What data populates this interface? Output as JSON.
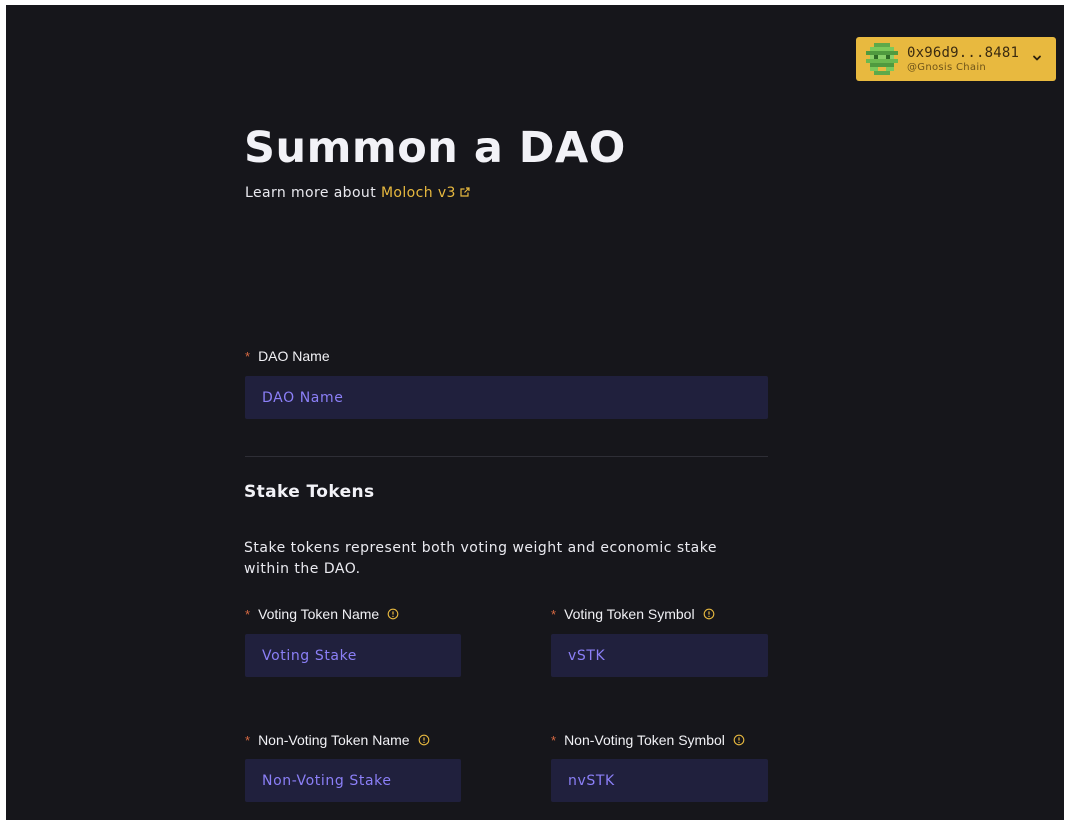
{
  "wallet": {
    "address": "0x96d9...8481",
    "network": "@Gnosis Chain",
    "avatar_icon": "pixel-avatar-icon",
    "chevron_icon": "chevron-down-icon",
    "color": "#e8b93f"
  },
  "header": {
    "title": "Summon a DAO",
    "learn_more_prefix": "Learn more about",
    "learn_more_link": "Moloch v3",
    "external_link_icon": "external-link-icon"
  },
  "form": {
    "dao_name": {
      "required_mark": "*",
      "label": "DAO Name",
      "placeholder": "DAO Name",
      "value": ""
    },
    "stake_tokens": {
      "title": "Stake Tokens",
      "description": "Stake tokens represent both voting weight and economic stake within the DAO.",
      "voting_token_name": {
        "required_mark": "*",
        "label": "Voting Token Name",
        "placeholder": "Voting Stake",
        "value": ""
      },
      "voting_token_symbol": {
        "required_mark": "*",
        "label": "Voting Token Symbol",
        "placeholder": "vSTK",
        "value": ""
      },
      "non_voting_token_name": {
        "required_mark": "*",
        "label": "Non-Voting Token Name",
        "placeholder": "Non-Voting Stake",
        "value": ""
      },
      "non_voting_token_symbol": {
        "required_mark": "*",
        "label": "Non-Voting Token Symbol",
        "placeholder": "nvSTK",
        "value": ""
      }
    }
  },
  "colors": {
    "background": "#16161b",
    "accent": "#e8b93f",
    "input_background": "#20203d",
    "input_text": "#8b7ff7",
    "required": "#d86a43"
  }
}
